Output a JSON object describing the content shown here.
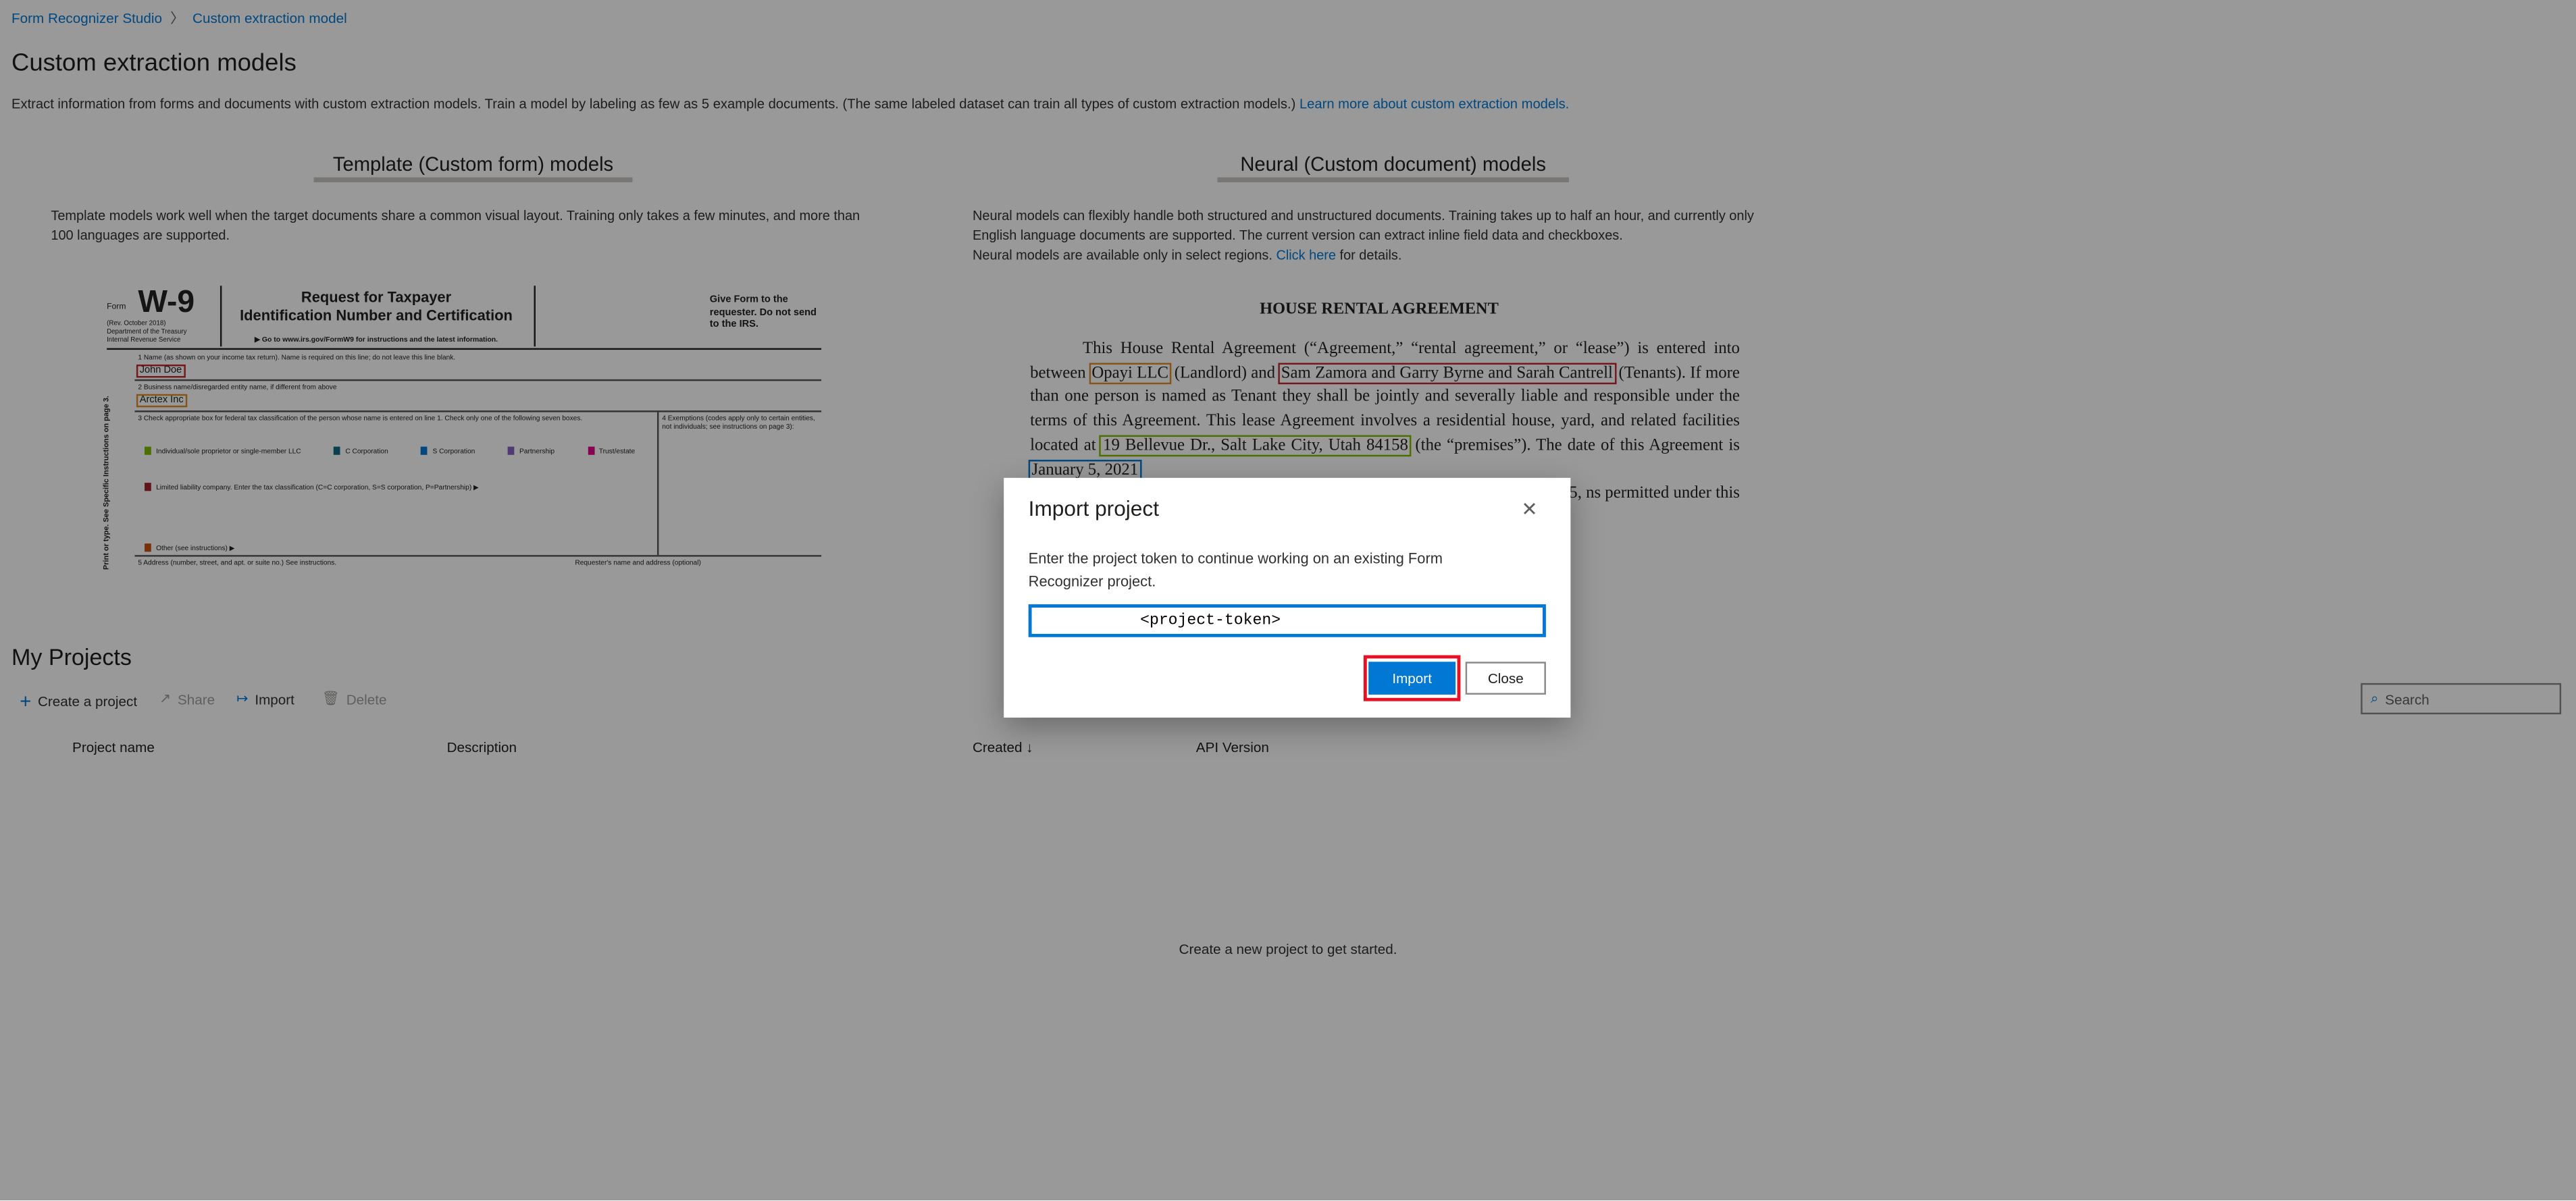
{
  "breadcrumb": {
    "items": [
      "Form Recognizer Studio",
      "Custom extraction model"
    ],
    "separator": ">"
  },
  "header": {
    "title": "Custom extraction models",
    "description": "Extract information from forms and documents with custom extraction models. Train a model by labeling as few as 5 example documents. (The same labeled dataset can train all types of custom extraction models.) ",
    "learn_more": "Learn more about custom extraction models."
  },
  "tabs": [
    {
      "label": "Template (Custom form) models",
      "text": "Template models work well when the target documents share a common visual layout. Training only takes a few minutes, and more than 100 languages are supported."
    },
    {
      "label": "Neural (Custom document) models",
      "text": "Neural models can flexibly handle both structured and unstructured documents. Training takes up to half an hour, and currently only English language documents are supported. The current version can extract inline field data and checkboxes.",
      "text2": "Neural models are available only in select regions. ",
      "link": "Click here",
      "text3": " for details."
    }
  ],
  "w9": {
    "form": "Form",
    "code": "W-9",
    "rev": "(Rev. October 2018)",
    "dept": "Department of the Treasury",
    "irs": "Internal Revenue Service",
    "title1": "Request for Taxpayer",
    "title2": "Identification Number and Certification",
    "goto": "▶ Go to www.irs.gov/FormW9 for instructions and the latest information.",
    "give": "Give Form to the requester. Do not send to the IRS.",
    "line1": "1 Name (as shown on your income tax return). Name is required on this line; do not leave this line blank.",
    "name": "John Doe",
    "line2": "2 Business name/disregarded entity name, if different from above",
    "business": "Arctex Inc",
    "line3": "3 Check appropriate box for federal tax classification of the person whose name is entered on line 1. Check only one of the following seven boxes.",
    "boxes": [
      "Individual/sole proprietor or single-member LLC",
      "C Corporation",
      "S Corporation",
      "Partnership",
      "Trust/estate"
    ],
    "llc": "Limited liability company. Enter the tax classification (C=C corporation, S=S corporation, P=Partnership) ▶",
    "other": "Other (see instructions) ▶",
    "line4": "4 Exemptions (codes apply only to certain entities, not individuals; see instructions on page 3):",
    "line5": "5 Address (number, street, and apt. or suite no.) See instructions.",
    "requester": "Requester's name and address (optional)",
    "side": "Print or type. See Specific Instructions on page 3."
  },
  "rental": {
    "title": "HOUSE RENTAL AGREEMENT",
    "p1a": "This House Rental Agreement (“Agreement,” “rental agreement,” or “lease”) is entered into between ",
    "landlord": "Opayi LLC",
    "p1b": " (Landlord) and ",
    "tenants": "Sam Zamora and Garry Byrne and Sarah Cantrell",
    "p1c": " (Tenants). If more than one person is named as Tenant they shall be jointly and severally liable and responsible under the terms of this Agreement. This lease Agreement involves a residential house, yard, and related facilities located at ",
    "address": "19 Bellevue Dr., Salt Lake City, Utah 84158",
    "p1d": " (the “premises”). The date of this Agreement is ",
    "date": "January 5, 2021",
    "p2": "month to month basis, days notice to the other commence on April 25, ns permitted under this"
  },
  "projects": {
    "title": "My Projects",
    "toolbar": {
      "create": "Create a project",
      "share": "Share",
      "import": "Import",
      "delete": "Delete",
      "search_placeholder": "Search"
    },
    "columns": [
      "Project name",
      "Description",
      "Created ↓",
      "API Version"
    ],
    "empty": "Create a new project to get started."
  },
  "dialog": {
    "title": "Import project",
    "text": "Enter the project token to continue working on an existing Form Recognizer project.",
    "token_value": "<project-token>",
    "import": "Import",
    "close": "Close"
  },
  "colors": {
    "accent": "#0078d4",
    "highlight": "#e81123"
  }
}
